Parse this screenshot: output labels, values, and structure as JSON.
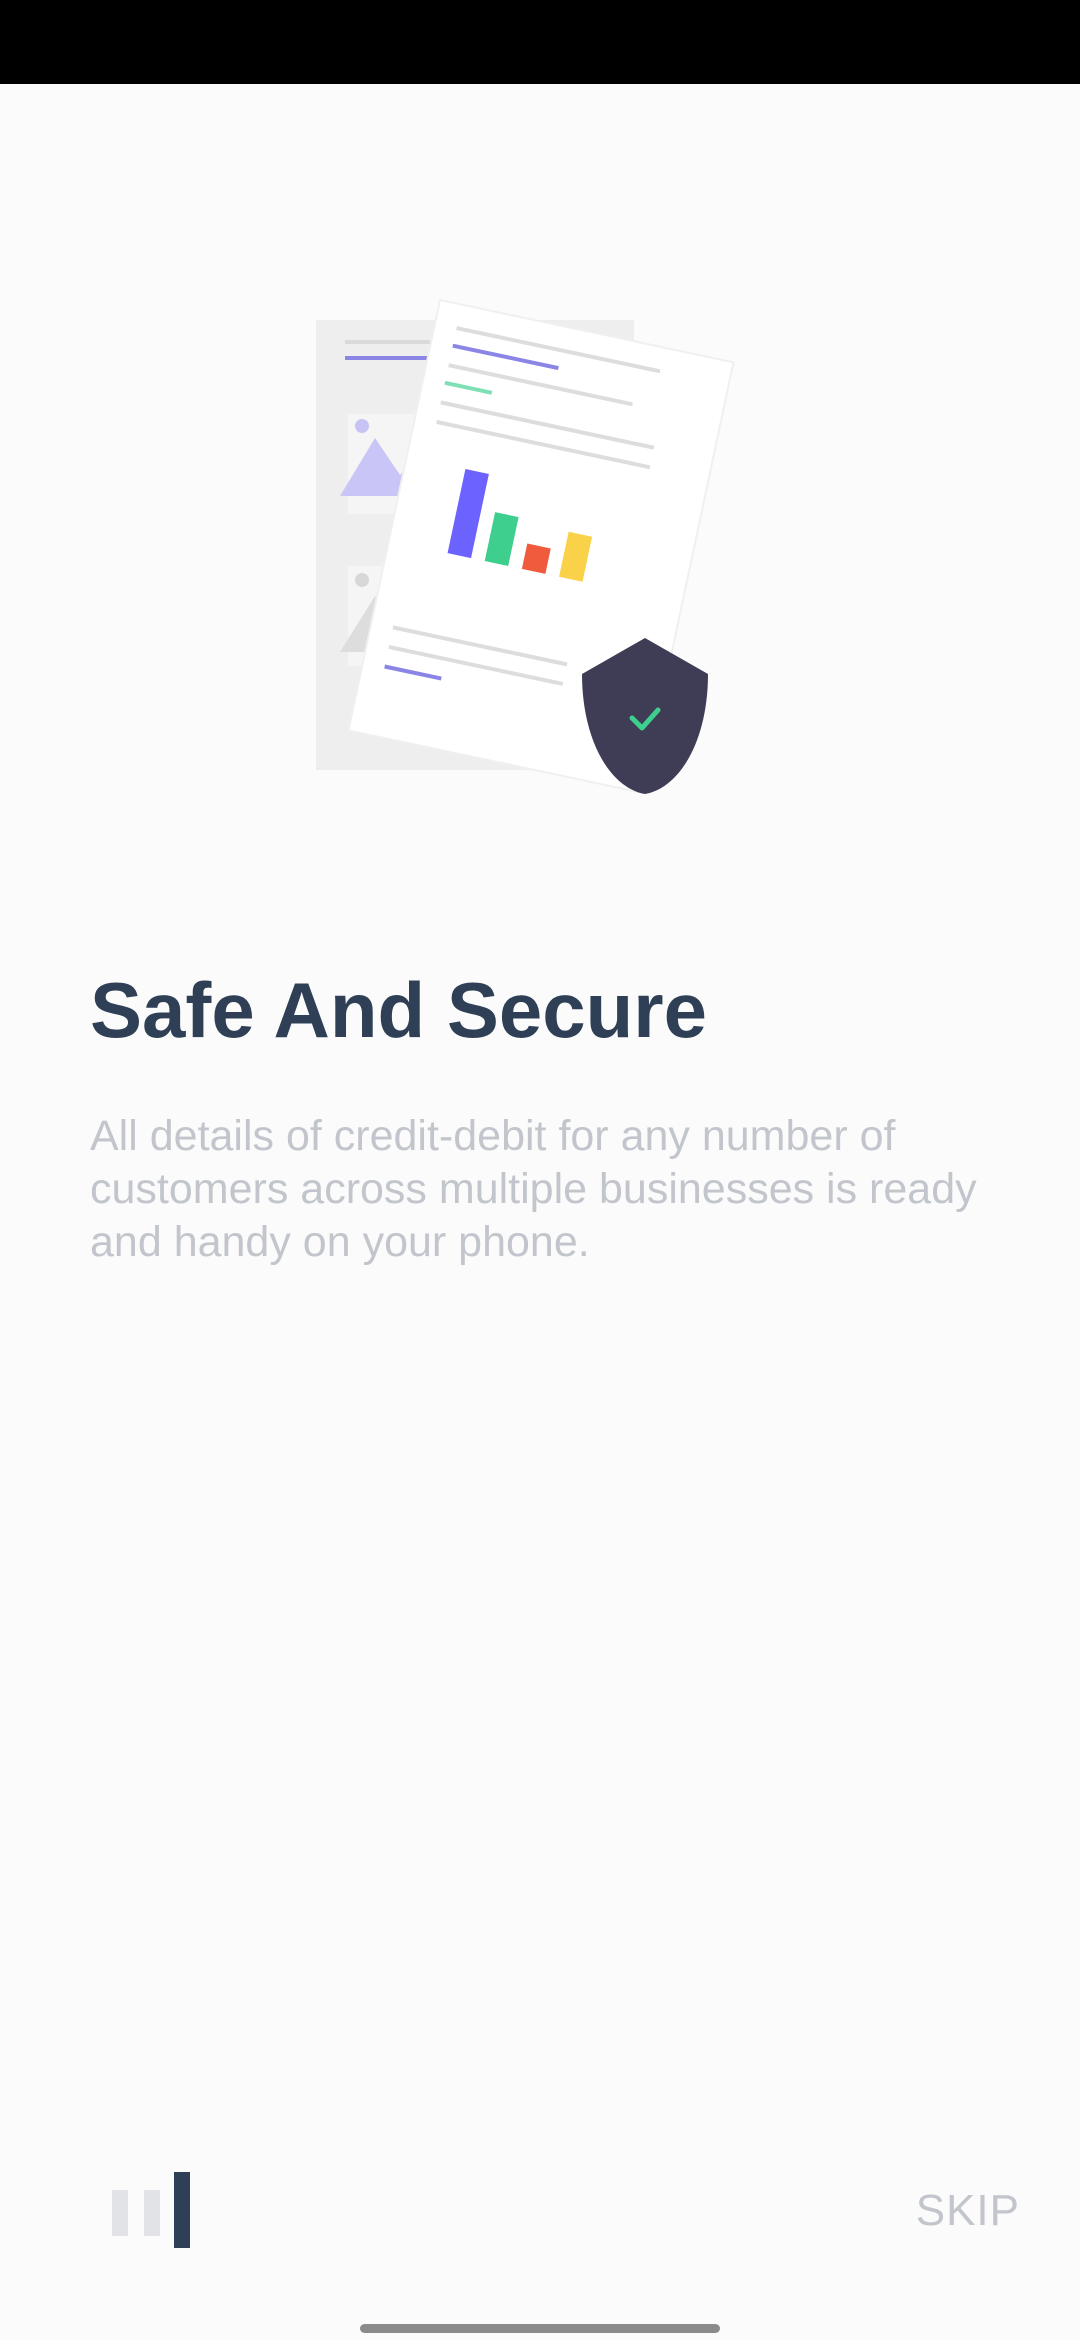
{
  "onboarding": {
    "title": "Safe And Secure",
    "description": "All details of credit-debit for any number of customers across multiple businesses is ready and handy on your phone.",
    "skip_label": "SKIP",
    "page_indicator": {
      "total": 3,
      "current": 3
    },
    "illustration": {
      "icon": "document-with-shield-illustration",
      "colors": {
        "primary_text": "#2e3f56",
        "muted_text": "#c2c6cc",
        "shield": "#3f3d56",
        "check": "#3ecf8e",
        "bar_purple": "#6c63ff",
        "bar_green": "#3ecf8e",
        "bar_red": "#f05a3d",
        "bar_yellow": "#f9d24a"
      }
    }
  }
}
